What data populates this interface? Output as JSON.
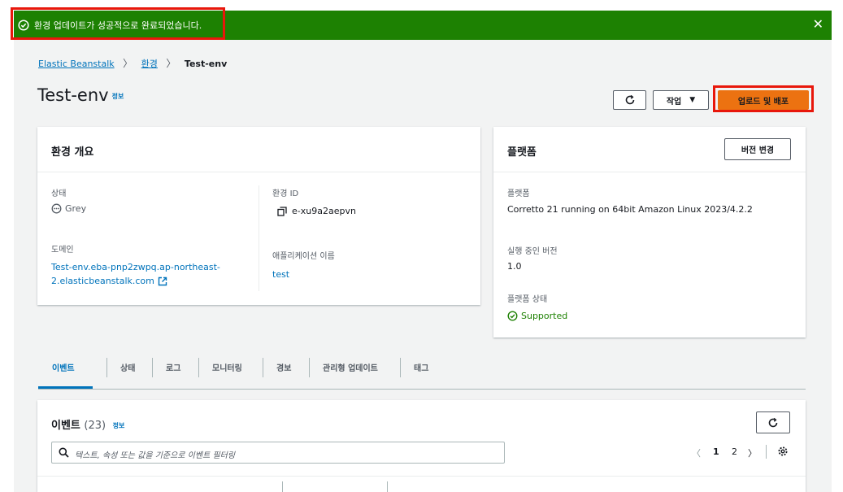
{
  "flash": {
    "message": "환경 업데이트가 성공적으로 완료되었습니다.",
    "close_glyph": "✕",
    "color": "#1d8102"
  },
  "breadcrumb": {
    "items": [
      "Elastic Beanstalk",
      "환경"
    ],
    "current": "Test-env",
    "separator": "〉"
  },
  "header": {
    "title": "Test-env",
    "info": "정보",
    "actions_label": "작업",
    "actions_caret": "▼",
    "deploy_label": "업로드 및 배포"
  },
  "overview": {
    "title": "환경 개요",
    "status_label": "상태",
    "status_value": "Grey",
    "domain_label": "도메인",
    "domain_value_line1": "Test-env.eba-pnp2zwpq.ap-northeast-",
    "domain_value_line2": "2.elasticbeanstalk.com",
    "env_id_label": "환경 ID",
    "env_id_value": "e-xu9a2aepvn",
    "app_name_label": "애플리케이션 이름",
    "app_name_value": "test"
  },
  "platform": {
    "title": "플랫폼",
    "change_version_label": "버전 변경",
    "platform_label": "플랫폼",
    "platform_value": "Corretto 21 running on 64bit Amazon Linux 2023/4.2.2",
    "running_version_label": "실행 중인 버전",
    "running_version_value": "1.0",
    "platform_state_label": "플랫폼 상태",
    "platform_state_value": "Supported"
  },
  "tabs": [
    "이벤트",
    "상태",
    "로그",
    "모니터링",
    "경보",
    "관리형 업데이트",
    "태그"
  ],
  "events": {
    "title": "이벤트",
    "count": "(23)",
    "info": "정보",
    "search_placeholder": "텍스트, 속성 또는 값을 기준으로 이벤트 필터링",
    "pager": {
      "prev": "〈",
      "pages": [
        "1",
        "2"
      ],
      "next": "〉"
    }
  },
  "colors": {
    "accent": "#0073bb",
    "primary_button": "#ec7211",
    "success": "#1d8102",
    "highlight_box": "#e8170b"
  }
}
